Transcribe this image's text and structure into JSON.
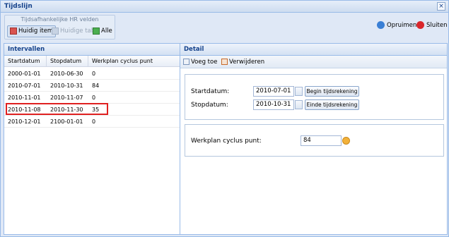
{
  "window": {
    "title": "Tijdslijn"
  },
  "toolbar": {
    "group_title": "Tijdsafhankelijke HR velden",
    "buttons": [
      {
        "label": "Huidig item"
      },
      {
        "label": "Huidige tab"
      },
      {
        "label": "Alle"
      }
    ],
    "cleanup_label": "Opruimen",
    "close_label": "Sluiten"
  },
  "intervals": {
    "title": "Intervallen",
    "columns": [
      "Startdatum",
      "Stopdatum",
      "Werkplan cyclus punt"
    ],
    "rows": [
      [
        "2000-01-01",
        "2010-06-30",
        "0"
      ],
      [
        "2010-07-01",
        "2010-10-31",
        "84"
      ],
      [
        "2010-11-01",
        "2010-11-07",
        "0"
      ],
      [
        "2010-11-08",
        "2010-11-30",
        "35"
      ],
      [
        "2010-12-01",
        "2100-01-01",
        "0"
      ]
    ]
  },
  "detail": {
    "title": "Detail",
    "add_label": "Voeg toe",
    "delete_label": "Verwijderen",
    "start_label": "Startdatum:",
    "start_value": "2010-07-01",
    "start_button": "Begin tijdsrekening",
    "stop_label": "Stopdatum:",
    "stop_value": "2010-10-31",
    "stop_button": "Einde tijdsrekening",
    "cycle_label": "Werkplan cyclus punt:",
    "cycle_value": "84"
  }
}
